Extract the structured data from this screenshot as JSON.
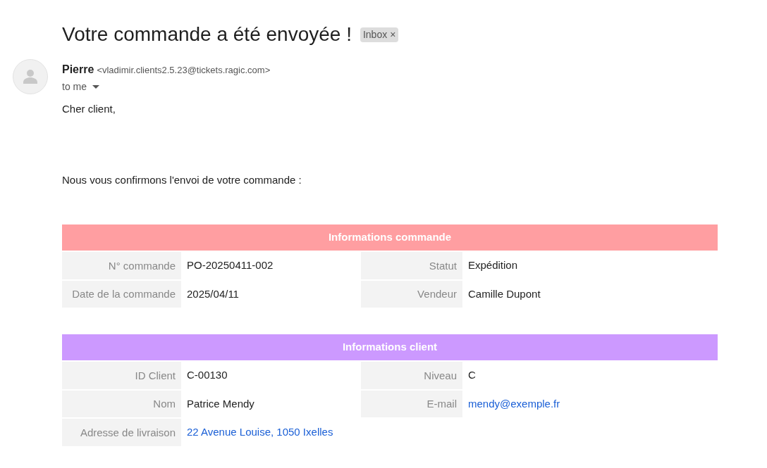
{
  "subject": "Votre commande a été envoyée !",
  "label_chip": {
    "text": "Inbox",
    "close": "×"
  },
  "sender": {
    "name": "Pierre",
    "address": "<vladimir.clients2.5.23@tickets.ragic.com>",
    "recipient": "to me"
  },
  "body": [
    "Cher client,",
    "Nous vous confirmons l'envoi de votre commande :"
  ],
  "sections": [
    {
      "title": "Informations commande",
      "color": "#ff9ea1",
      "rows": [
        [
          {
            "label": "N° commande",
            "value": "PO-20250411-002",
            "kind": "text"
          },
          {
            "label": "Statut",
            "value": "Expédition",
            "kind": "text"
          }
        ],
        [
          {
            "label": "Date de la commande",
            "value": "2025/04/11",
            "kind": "text"
          },
          {
            "label": "Vendeur",
            "value": "Camille Dupont",
            "kind": "text"
          }
        ]
      ]
    },
    {
      "title": "Informations client",
      "color": "#cc99ff",
      "rows": [
        [
          {
            "label": "ID Client",
            "value": "C-00130",
            "kind": "text"
          },
          {
            "label": "Niveau",
            "value": "C",
            "kind": "text"
          }
        ],
        [
          {
            "label": "Nom",
            "value": "Patrice Mendy",
            "kind": "text"
          },
          {
            "label": "E-mail",
            "value": "mendy@exemple.fr",
            "kind": "link"
          }
        ],
        [
          {
            "label": "Adresse de livraison",
            "value": "22 Avenue Louise, 1050 Ixelles",
            "kind": "link"
          }
        ]
      ]
    }
  ]
}
